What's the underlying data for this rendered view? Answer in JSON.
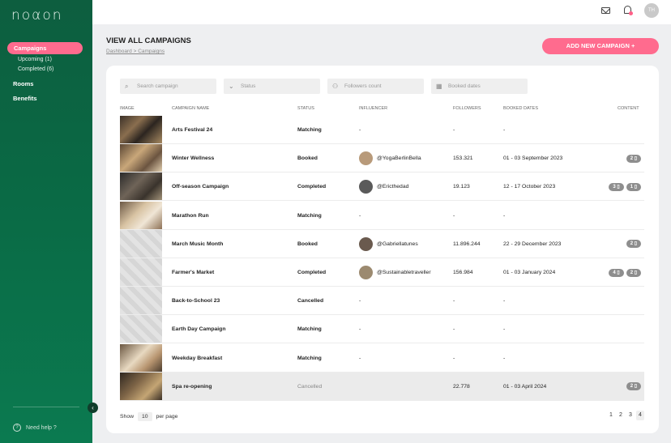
{
  "app": {
    "logo": "noαon"
  },
  "sidebar": {
    "active_item": "Campaigns",
    "sub_items": [
      "Upcoming (1)",
      "Completed (6)"
    ],
    "items": [
      "Rooms",
      "Benefits"
    ],
    "help": "Need help ?",
    "collapse_glyph": "‹"
  },
  "topbar": {
    "avatar_initials": "TH"
  },
  "header": {
    "title": "VIEW ALL CAMPAIGNS",
    "breadcrumb": "Dashboard > Campaigns",
    "add_button": "ADD NEW CAMPAIGN +"
  },
  "filters": {
    "search": "Search campaign",
    "status": "Status",
    "followers": "Followers count",
    "dates": "Booked dates"
  },
  "table": {
    "columns": [
      "IMAGE",
      "CAMPAIGN NAME",
      "STATUS",
      "INFLUENCER",
      "FOLLOWERS",
      "BOOKED DATES",
      "CONTENT"
    ],
    "rows": [
      {
        "name": "Arts Festival 24",
        "status": "Matching",
        "influencer": "-",
        "followers": "-",
        "dates": "-",
        "badges": []
      },
      {
        "name": "Winter Wellness",
        "status": "Booked",
        "influencer": "@YogaBerlinBella",
        "followers": "153.321",
        "dates": "01 - 03 September 2023",
        "badges": [
          "2 ▯"
        ]
      },
      {
        "name": "Off-season Campaign",
        "status": "Completed",
        "influencer": "@Ericthedad",
        "followers": "19.123",
        "dates": "12 - 17 October 2023",
        "badges": [
          "3 ▯",
          "1 ▯"
        ]
      },
      {
        "name": "Marathon Run",
        "status": "Matching",
        "influencer": "-",
        "followers": "-",
        "dates": "-",
        "badges": []
      },
      {
        "name": "March Music Month",
        "status": "Booked",
        "influencer": "@Gabriellatunes",
        "followers": "11.896.244",
        "dates": "22 - 29 December 2023",
        "badges": [
          "2 ▯"
        ]
      },
      {
        "name": "Farmer's Market",
        "status": "Completed",
        "influencer": "@Sustainabletraveller",
        "followers": "156.984",
        "dates": "01 - 03 January 2024",
        "badges": [
          "4 ▯",
          "2 ▯"
        ]
      },
      {
        "name": "Back-to-School 23",
        "status": "Cancelled",
        "influencer": "-",
        "followers": "-",
        "dates": "-",
        "badges": []
      },
      {
        "name": "Earth Day Campaign",
        "status": "Matching",
        "influencer": "-",
        "followers": "-",
        "dates": "-",
        "badges": []
      },
      {
        "name": "Weekday Breakfast",
        "status": "Matching",
        "influencer": "-",
        "followers": "-",
        "dates": "-",
        "badges": []
      },
      {
        "name": "Spa re-opening",
        "status": "Cancelled",
        "influencer": "",
        "followers": "22.778",
        "dates": "01 - 03 April 2024",
        "badges": [
          "2 ▯"
        ]
      }
    ]
  },
  "footer": {
    "show_label": "Show",
    "page_size": "10",
    "per_page_label": "per page",
    "pages": [
      "1",
      "2",
      "3",
      "4"
    ],
    "current_page": "4"
  }
}
